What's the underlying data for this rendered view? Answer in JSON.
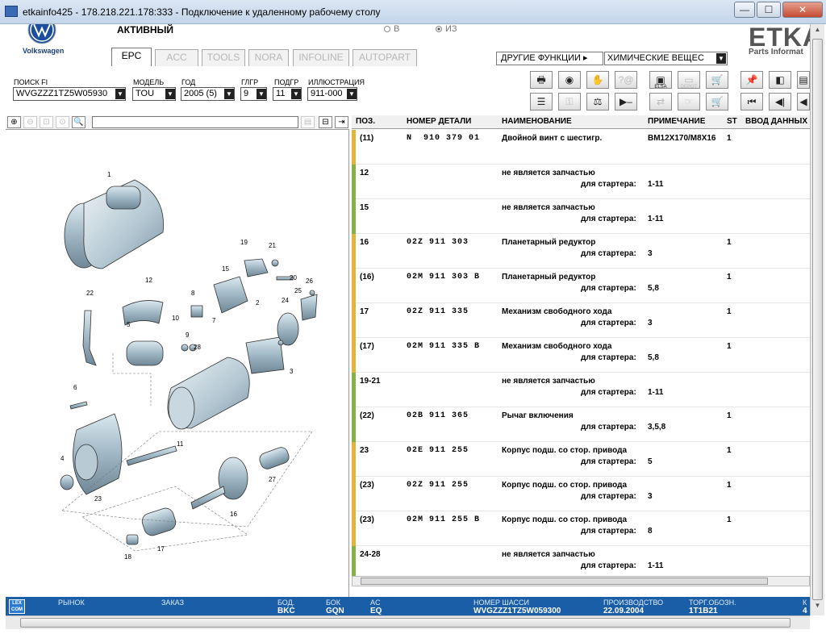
{
  "window": {
    "title": "etkainfo425 - 178.218.221.178:333 - Подключение к удаленному рабочему столу",
    "minimize": "—",
    "maximize": "☐",
    "close": "✕"
  },
  "brand": {
    "vw_text": "Volkswagen",
    "etka": "ETKA",
    "etka_sub": "Parts Informat"
  },
  "header": {
    "status": "АКТИВНЫЙ",
    "radio_v": "В",
    "radio_iz": "ИЗ",
    "tabs": [
      "EPC",
      "ACC",
      "TOOLS",
      "NORA",
      "INFOLINE",
      "AUTOPART"
    ],
    "more_functions": "ДРУГИЕ ФУНКЦИИ ▸",
    "chem_select": "ХИМИЧЕСКИЕ ВЕЩЕС"
  },
  "filters": {
    "search_label": "ПОИСК FI",
    "search_value": "WVGZZZ1TZ5W05930",
    "model_label": "МОДЕЛЬ",
    "model_value": "TOU",
    "year_label": "ГОД",
    "year_value": "2005 (5)",
    "hg_label": "ГЛГР",
    "hg_value": "9",
    "ug_label": "ПОДГР",
    "ug_value": "11",
    "illus_label": "ИЛЛЮСТРАЦИЯ",
    "illus_value": "911-000"
  },
  "toolbar": {
    "elsa_label": "ELSA",
    "depot_label": "DEPOT"
  },
  "table": {
    "headers": [
      "ПОЗ.",
      "НОМЕР ДЕТАЛИ",
      "НАИМЕНОВАНИЕ",
      "ПРИМЕЧАНИЕ",
      "ST",
      "ВВОД ДАННЫХ"
    ],
    "sub_label": "для стартера:",
    "rows": [
      {
        "pos": "(11)",
        "part": "N  910 379 01",
        "name": "Двойной винт с шестигр.",
        "note": "BM12X170/M8X16",
        "st": "1",
        "sub": "",
        "color": "#e0b63c"
      },
      {
        "pos": "12",
        "part": "",
        "name": "не является запчастью",
        "note": "",
        "st": "",
        "sub": "1-11",
        "color": "#8ab04a"
      },
      {
        "pos": "15",
        "part": "",
        "name": "не является запчастью",
        "note": "",
        "st": "",
        "sub": "1-11",
        "color": "#8ab04a"
      },
      {
        "pos": "16",
        "part": "02Z 911 303",
        "name": "Планетарный редуктор",
        "note": "",
        "st": "1",
        "sub": "3",
        "color": "#e0b63c"
      },
      {
        "pos": "(16)",
        "part": "02M 911 303 B",
        "name": "Планетарный редуктор",
        "note": "",
        "st": "1",
        "sub": "5,8",
        "color": "#e0b63c"
      },
      {
        "pos": "17",
        "part": "02Z 911 335",
        "name": "Механизм свободного хода",
        "note": "",
        "st": "1",
        "sub": "3",
        "color": "#e0b63c"
      },
      {
        "pos": "(17)",
        "part": "02M 911 335 B",
        "name": "Механизм свободного хода",
        "note": "",
        "st": "1",
        "sub": "5,8",
        "color": "#e0b63c"
      },
      {
        "pos": "19-21",
        "part": "",
        "name": "не является запчастью",
        "note": "",
        "st": "",
        "sub": "1-11",
        "color": "#8ab04a"
      },
      {
        "pos": "(22)",
        "part": "02B 911 365",
        "name": "Рычаг включения",
        "note": "",
        "st": "1",
        "sub": "3,5,8",
        "color": "#8ab04a"
      },
      {
        "pos": "23",
        "part": "02E 911 255",
        "name": "Корпус подш. со стор. привода",
        "note": "",
        "st": "1",
        "sub": "5",
        "color": "#e0b63c"
      },
      {
        "pos": "(23)",
        "part": "02Z 911 255",
        "name": "Корпус подш. со стор. привода",
        "note": "",
        "st": "1",
        "sub": "3",
        "color": "#e0b63c"
      },
      {
        "pos": "(23)",
        "part": "02M 911 255 B",
        "name": "Корпус подш. со стор. привода",
        "note": "",
        "st": "1",
        "sub": "8",
        "color": "#e0b63c"
      },
      {
        "pos": "24-28",
        "part": "",
        "name": "не является запчастью",
        "note": "",
        "st": "",
        "sub": "1-11",
        "color": "#8ab04a"
      }
    ]
  },
  "illustration": {
    "callouts": [
      "1",
      "2",
      "3",
      "4",
      "5",
      "6",
      "7",
      "8",
      "9",
      "10",
      "11",
      "12",
      "15",
      "16",
      "17",
      "18",
      "19",
      "20",
      "21",
      "22",
      "23",
      "24",
      "25",
      "26",
      "27",
      "28"
    ]
  },
  "statusbar": {
    "lex": "LEX COM",
    "market_label": "РЫНОК",
    "order_label": "ЗАКАЗ",
    "bod_label": "БОД.",
    "bod_value": "BKC",
    "box_label": "БОК",
    "box_value": "GQN",
    "ac_label": "AC",
    "ac_value": "EQ",
    "vin_label": "НОМЕР ШАССИ",
    "vin_value": "WVGZZZ1TZ5W059300",
    "prod_label": "ПРОИЗВОДСТВО",
    "prod_value": "22.09.2004",
    "torg_label": "ТОРГ.ОБОЗН.",
    "torg_value": "1T1B21",
    "k_label": "К",
    "k_value": "4"
  }
}
